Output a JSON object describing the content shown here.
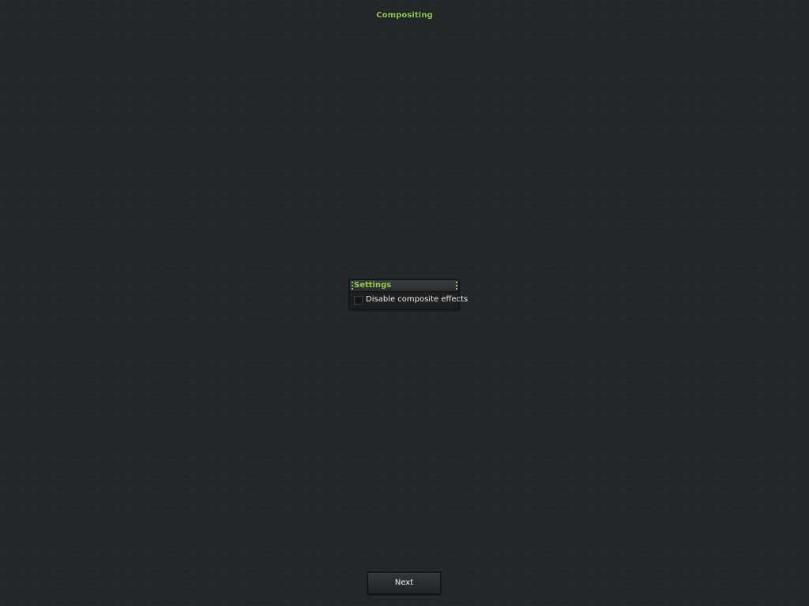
{
  "page": {
    "title": "Compositing"
  },
  "settings_frame": {
    "title": "Settings",
    "checkbox_label": "Disable composite effects",
    "checkbox_checked": false
  },
  "footer": {
    "next_label": "Next"
  },
  "colors": {
    "background": "#23272a",
    "accent": "#8fce3f",
    "text": "#eeeeee"
  }
}
